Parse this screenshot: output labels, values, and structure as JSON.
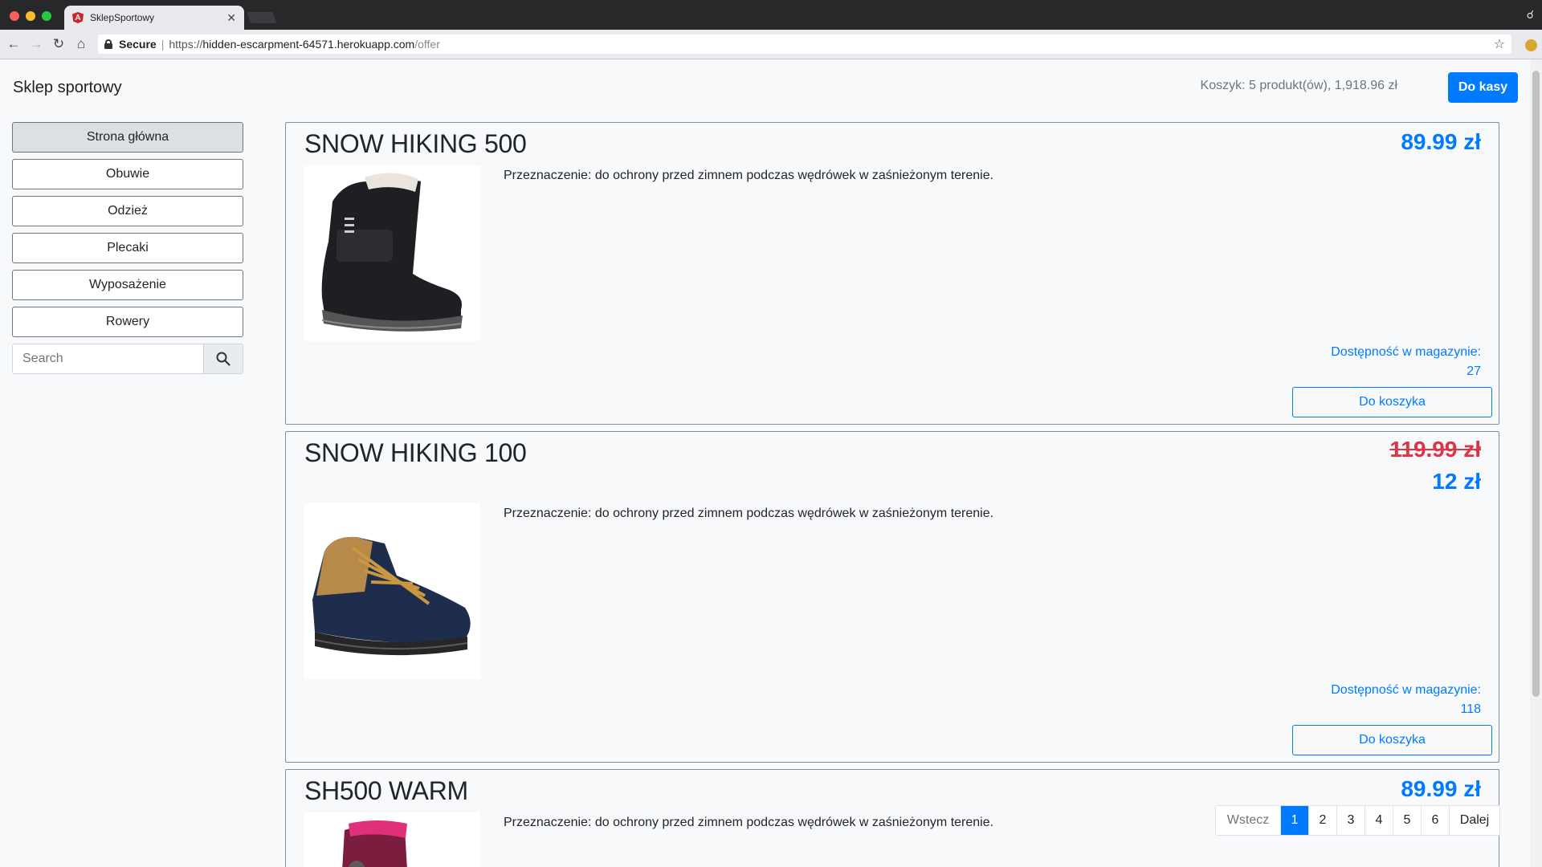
{
  "browser": {
    "tab_title": "SklepSportowy",
    "tab_favicon_letter": "A",
    "secure_label": "Secure",
    "url_scheme": "https://",
    "url_host": "hidden-escarpment-64571.herokuapp.com",
    "url_path": "/offer"
  },
  "header": {
    "brand": "Sklep sportowy",
    "cart_summary": "Koszyk: 5 produkt(ów), 1,918.96 zł",
    "checkout_label": "Do kasy"
  },
  "sidebar": {
    "categories": [
      {
        "label": "Strona główna",
        "active": true
      },
      {
        "label": "Obuwie"
      },
      {
        "label": "Odzież"
      },
      {
        "label": "Plecaki"
      },
      {
        "label": "Wyposażenie"
      },
      {
        "label": "Rowery"
      }
    ],
    "search_placeholder": "Search"
  },
  "products": [
    {
      "name": "SNOW HIKING 500",
      "price": "89.99 zł",
      "description": "Przeznaczenie: do ochrony przed zimnem podczas wędrówek w zaśnieżonym terenie.",
      "stock_label": "Dostępność w magazynie:",
      "stock": "27",
      "add_label": "Do koszyka"
    },
    {
      "name": "SNOW HIKING 100",
      "old_price": "119.99 zł",
      "price": "12 zł",
      "description": "Przeznaczenie: do ochrony przed zimnem podczas wędrówek w zaśnieżonym terenie.",
      "stock_label": "Dostępność w magazynie:",
      "stock": "118",
      "add_label": "Do koszyka"
    },
    {
      "name": "SH500 WARM",
      "price": "89.99 zł",
      "description": "Przeznaczenie: do ochrony przed zimnem podczas wędrówek w zaśnieżonym terenie."
    }
  ],
  "pagination": {
    "prev": "Wstecz",
    "pages": [
      "1",
      "2",
      "3",
      "4",
      "5",
      "6"
    ],
    "current": "1",
    "next": "Dalej"
  },
  "colors": {
    "primary": "#007bff",
    "danger": "#dc3545",
    "text": "#212529",
    "muted": "#6c757d"
  }
}
